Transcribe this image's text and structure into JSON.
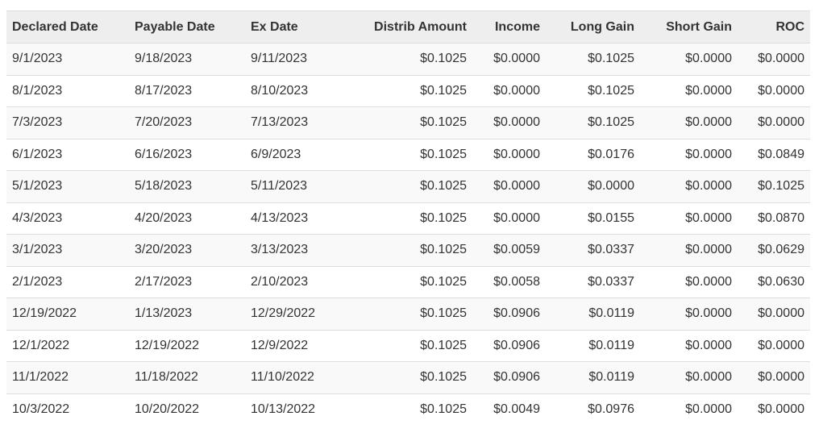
{
  "table": {
    "headers": [
      "Declared Date",
      "Payable Date",
      "Ex Date",
      "Distrib Amount",
      "Income",
      "Long Gain",
      "Short Gain",
      "ROC"
    ],
    "rows": [
      [
        "9/1/2023",
        "9/18/2023",
        "9/11/2023",
        "$0.1025",
        "$0.0000",
        "$0.1025",
        "$0.0000",
        "$0.0000"
      ],
      [
        "8/1/2023",
        "8/17/2023",
        "8/10/2023",
        "$0.1025",
        "$0.0000",
        "$0.1025",
        "$0.0000",
        "$0.0000"
      ],
      [
        "7/3/2023",
        "7/20/2023",
        "7/13/2023",
        "$0.1025",
        "$0.0000",
        "$0.1025",
        "$0.0000",
        "$0.0000"
      ],
      [
        "6/1/2023",
        "6/16/2023",
        "6/9/2023",
        "$0.1025",
        "$0.0000",
        "$0.0176",
        "$0.0000",
        "$0.0849"
      ],
      [
        "5/1/2023",
        "5/18/2023",
        "5/11/2023",
        "$0.1025",
        "$0.0000",
        "$0.0000",
        "$0.0000",
        "$0.1025"
      ],
      [
        "4/3/2023",
        "4/20/2023",
        "4/13/2023",
        "$0.1025",
        "$0.0000",
        "$0.0155",
        "$0.0000",
        "$0.0870"
      ],
      [
        "3/1/2023",
        "3/20/2023",
        "3/13/2023",
        "$0.1025",
        "$0.0059",
        "$0.0337",
        "$0.0000",
        "$0.0629"
      ],
      [
        "2/1/2023",
        "2/17/2023",
        "2/10/2023",
        "$0.1025",
        "$0.0058",
        "$0.0337",
        "$0.0000",
        "$0.0630"
      ],
      [
        "12/19/2022",
        "1/13/2023",
        "12/29/2022",
        "$0.1025",
        "$0.0906",
        "$0.0119",
        "$0.0000",
        "$0.0000"
      ],
      [
        "12/1/2022",
        "12/19/2022",
        "12/9/2022",
        "$0.1025",
        "$0.0906",
        "$0.0119",
        "$0.0000",
        "$0.0000"
      ],
      [
        "11/1/2022",
        "11/18/2022",
        "11/10/2022",
        "$0.1025",
        "$0.0906",
        "$0.0119",
        "$0.0000",
        "$0.0000"
      ],
      [
        "10/3/2022",
        "10/20/2022",
        "10/13/2022",
        "$0.1025",
        "$0.0049",
        "$0.0976",
        "$0.0000",
        "$0.0000"
      ]
    ]
  }
}
